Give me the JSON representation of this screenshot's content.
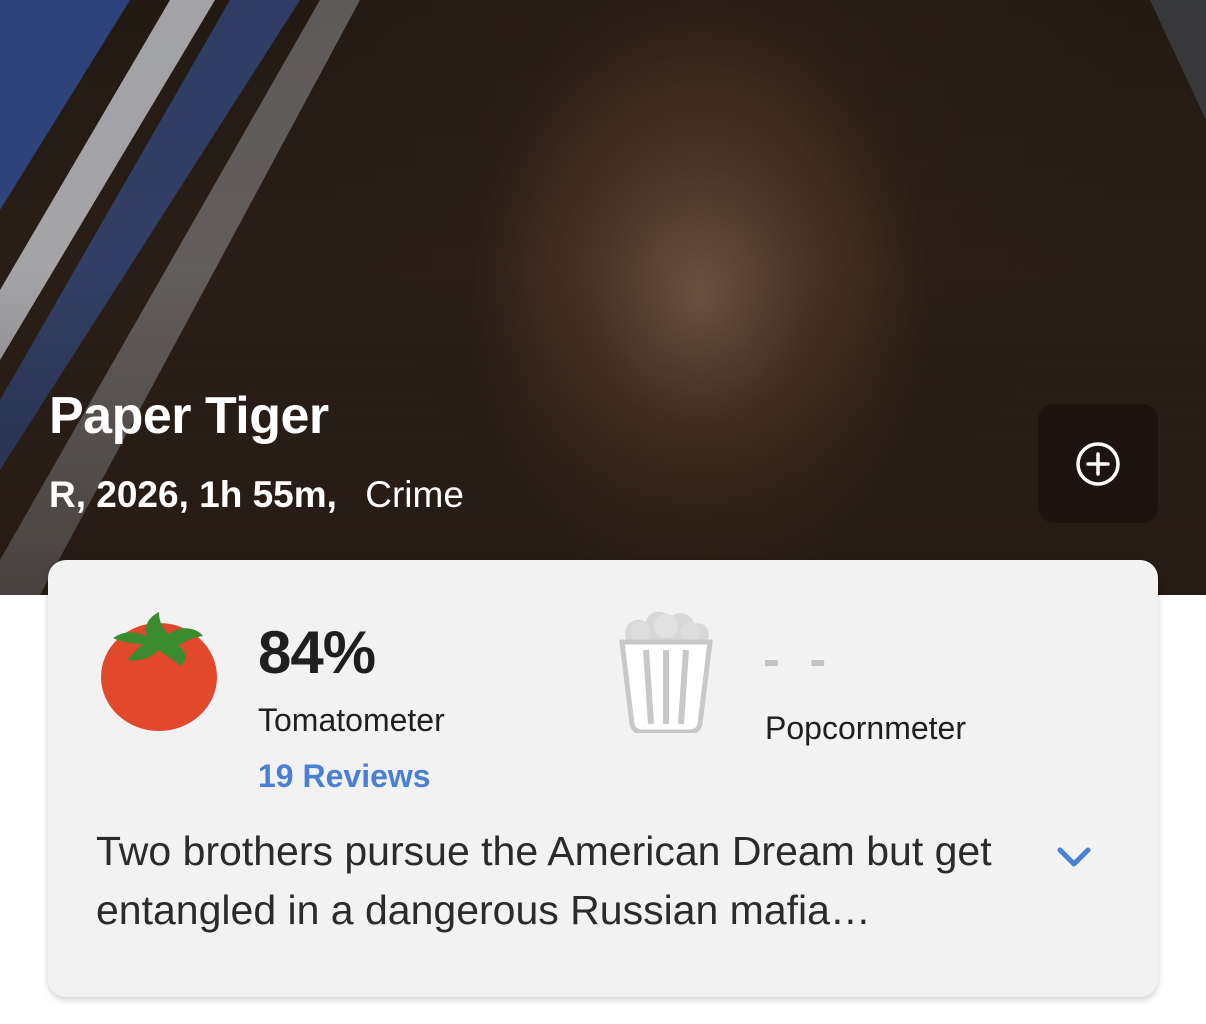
{
  "movie": {
    "title": "Paper Tiger",
    "meta": "R, 2026, 1h 55m,",
    "genre": "Crime",
    "synopsis": "Two brothers pursue the American Dream but get entangled in a dangerous Russian mafia…"
  },
  "actions": {
    "add_icon": "plus-circle-icon"
  },
  "ratings": {
    "tomatometer": {
      "score": "84%",
      "label": "Tomatometer",
      "reviews": "19 Reviews",
      "icon": "tomato-icon"
    },
    "popcornmeter": {
      "score": "- -",
      "label": "Popcornmeter",
      "icon": "popcorn-bucket-icon"
    }
  },
  "colors": {
    "link": "#4a7fd4",
    "tomato": "#e2482c",
    "leaf": "#3a8c2e",
    "card": "#f2f2f2",
    "muted": "#c3c3c3"
  }
}
